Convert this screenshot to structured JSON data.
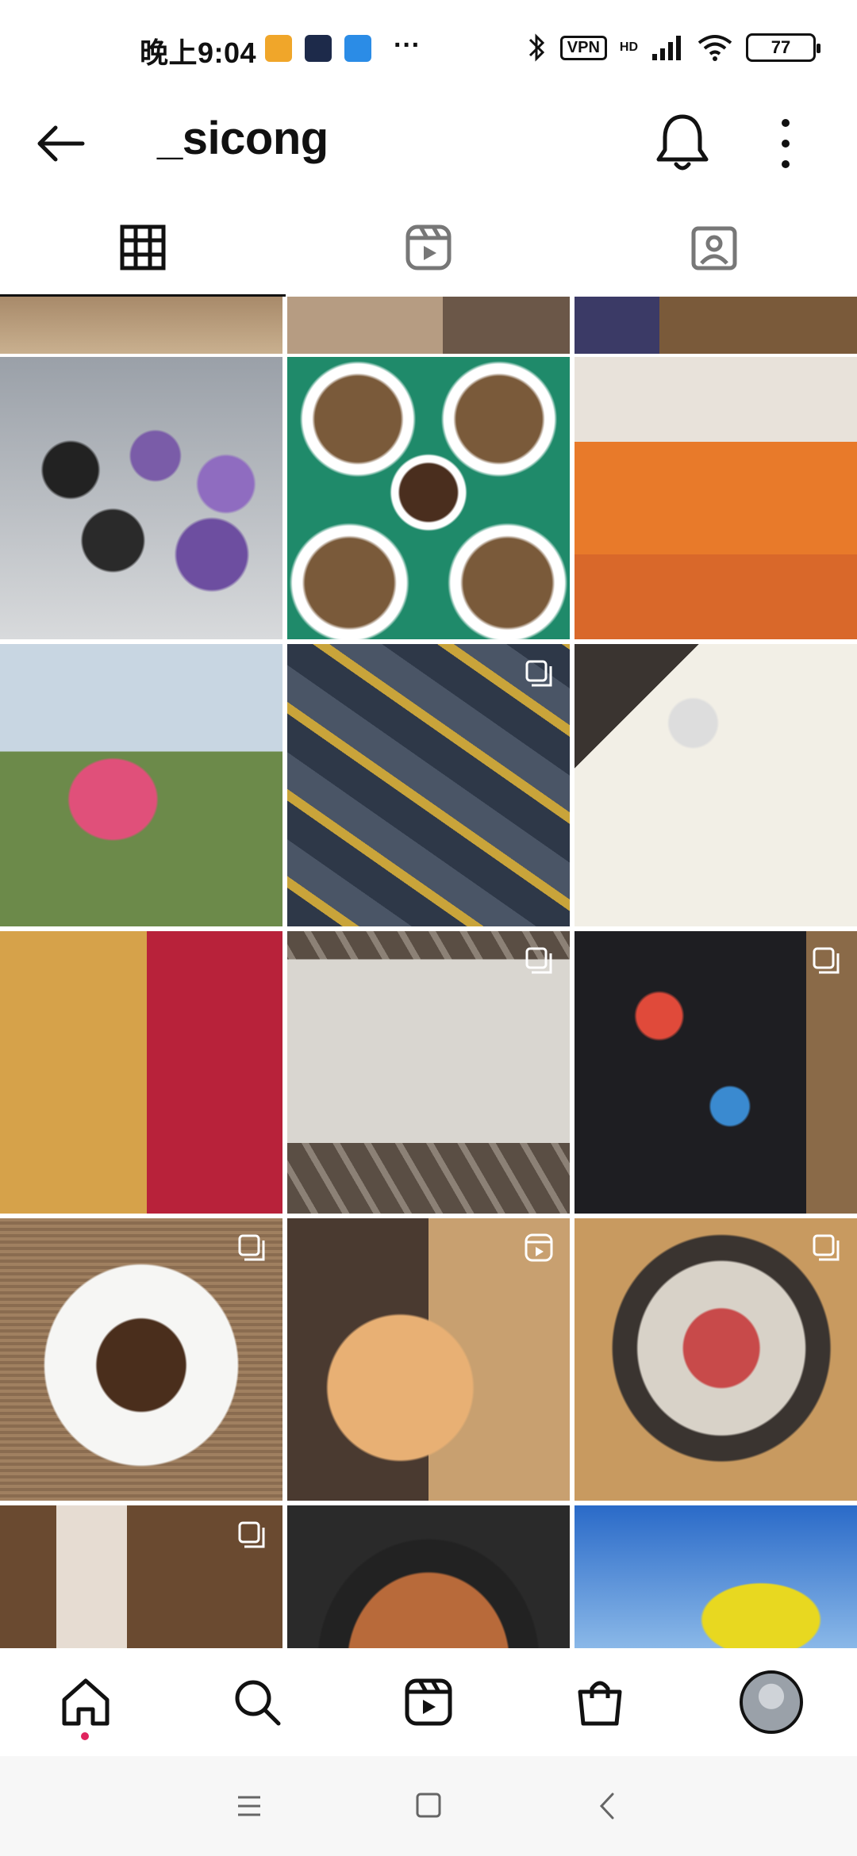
{
  "status": {
    "time": "晚上9:04",
    "more_indicator": "···",
    "vpn": "VPN",
    "network": "HD",
    "battery": "77"
  },
  "header": {
    "username": "_sicong",
    "back_icon": "arrow-left-icon",
    "bell_icon": "bell-icon",
    "more_icon": "more-vertical-icon"
  },
  "tabs": [
    {
      "name": "posts",
      "icon": "grid-icon",
      "active": true
    },
    {
      "name": "reels",
      "icon": "reels-icon",
      "active": false
    },
    {
      "name": "tagged",
      "icon": "tagged-person-icon",
      "active": false
    }
  ],
  "bottom_nav": [
    {
      "name": "home",
      "icon": "home-icon",
      "active": true
    },
    {
      "name": "search",
      "icon": "search-icon"
    },
    {
      "name": "reels",
      "icon": "reels-icon"
    },
    {
      "name": "shop",
      "icon": "shop-bag-icon"
    },
    {
      "name": "profile",
      "icon": "avatar"
    }
  ],
  "colors": {
    "notification_dot": "#e0245e",
    "accent_text": "#111111"
  }
}
